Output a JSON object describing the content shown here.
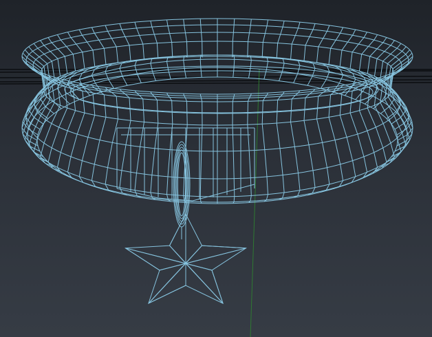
{
  "viewport": {
    "view": "perspective",
    "display_mode": "wireframe"
  },
  "colors": {
    "background_top": "#1f2329",
    "background_bottom": "#363c45",
    "wireframe": "#86c3de",
    "grid_line": "#0b0d10",
    "y_axis": "#2f7a32"
  },
  "scene": {
    "objects": [
      {
        "name": "collar",
        "type": "torus-band"
      },
      {
        "name": "buckle",
        "type": "plate"
      },
      {
        "name": "ring",
        "type": "loop"
      },
      {
        "name": "star-pendant",
        "type": "five-point-star"
      }
    ]
  }
}
